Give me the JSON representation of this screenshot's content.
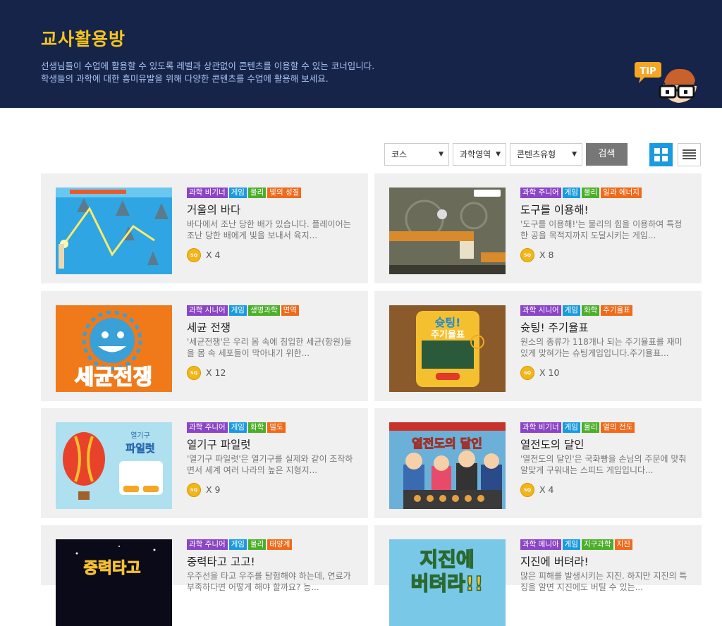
{
  "header": {
    "title": "교사활용방",
    "desc_line1": "선생님들이 수업에 활용할 수 있도록 레벨과 상관없이 콘텐츠를 이용할 수 있는 코너입니다.",
    "desc_line2": "학생들의 과학에 대한 흥미유발을 위해 다양한 콘텐츠를 수업에 활용해 보세요.",
    "tip_label": "TIP"
  },
  "filters": {
    "course": "코스",
    "area": "과학영역",
    "content_type": "콘텐츠유형",
    "search_label": "검색"
  },
  "colors": {
    "header_bg": "#16244a",
    "title": "#f5c518",
    "accent": "#1a9be0"
  },
  "coin_label": "SQ",
  "cards": [
    {
      "tags": [
        "과학 비기너",
        "게임",
        "물리",
        "빛의 성질"
      ],
      "title": "거울의 바다",
      "desc": "바다에서 조난 당한 배가 있습니다. 플레이어는 조난 당한 배에게 빛을 보내서 육지...",
      "count": "X 4"
    },
    {
      "tags": [
        "과학 주니어",
        "게임",
        "물리",
        "일과 에너지"
      ],
      "title": "도구를 이용해!",
      "desc": "'도구를 이용해!'는 물리의 힘을 이용하여 특정한 공을 목적지까지 도달시키는 게임...",
      "count": "X 8"
    },
    {
      "tags": [
        "과학 시니어",
        "게임",
        "생명과학",
        "면역"
      ],
      "title": "세균 전쟁",
      "desc": "'세균전쟁'은 우리 몸 속에 침입한 세균(항원)들을 몸 속 세포들이 막아내기 위한...",
      "count": "X 12"
    },
    {
      "tags": [
        "과학 시니어",
        "게임",
        "화학",
        "주기율표"
      ],
      "title": "슛팅! 주기율표",
      "desc": "원소의 종류가 118개나 되는 주기율표를 재미있게 맞혀가는 슈팅게임입니다.주기율표...",
      "count": "X 10"
    },
    {
      "tags": [
        "과학 주니어",
        "게임",
        "화학",
        "밀도"
      ],
      "title": "열기구 파일럿",
      "desc": "'열기구 파일럿'은 열기구를 실제와 같이 조작하면서 세계 여러 나라의 높은 지형지...",
      "count": "X 9"
    },
    {
      "tags": [
        "과학 비기너",
        "게임",
        "물리",
        "열의 전도"
      ],
      "title": "열전도의 달인",
      "desc": "'열전도의 달인'은 국화빵을 손님의 주문에 맞춰 알맞게 구워내는 스피드 게임입니다...",
      "count": "X 4"
    },
    {
      "tags": [
        "과학 주니어",
        "게임",
        "물리",
        "태양계"
      ],
      "title": "중력타고 고고!",
      "desc": "우주선을 타고 우주를 탐험해야 하는데, 연료가 부족하다면 어떻게 해야 할까요? 능...",
      "count": ""
    },
    {
      "tags": [
        "과학 메니아",
        "게임",
        "지구과학",
        "지진"
      ],
      "title": "지진에 버텨라!",
      "desc": "많은 피해를 발생시키는 지진. 하지만 지진의 특징을 알면 지진에도 버틸 수 있는...",
      "count": ""
    }
  ],
  "thumb_text": {
    "thumb3": "세균전쟁",
    "thumb4_a": "슛팅!",
    "thumb4_b": "주기율표",
    "thumb5_a": "열기구",
    "thumb5_b": "파일럿",
    "thumb6": "열전도의 달인",
    "thumb7": "중력타고",
    "thumb8_a": "지진에",
    "thumb8_b": "버텨라!!"
  }
}
